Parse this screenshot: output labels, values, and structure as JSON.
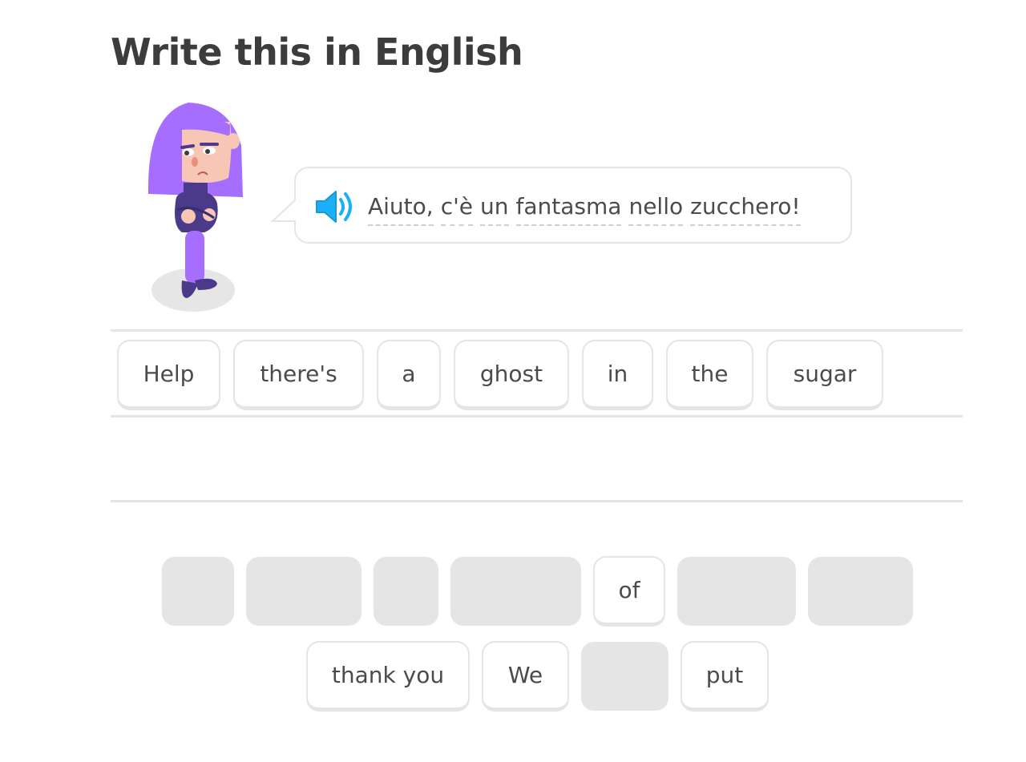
{
  "header": {
    "title": "Write this in English"
  },
  "prompt": {
    "speaker_icon": "speaker-icon",
    "tokens": [
      "Aiuto,",
      "c'è",
      "un",
      "fantasma",
      "nello",
      "zucchero!"
    ]
  },
  "answer": {
    "tiles": [
      "Help",
      "there's",
      "a",
      "ghost",
      "in",
      "the",
      "sugar"
    ]
  },
  "word_bank": {
    "row1": [
      {
        "label": "",
        "used": true
      },
      {
        "label": "",
        "used": true
      },
      {
        "label": "",
        "used": true
      },
      {
        "label": "",
        "used": true
      },
      {
        "label": "of",
        "used": false
      },
      {
        "label": "",
        "used": true
      },
      {
        "label": "",
        "used": true
      }
    ],
    "row2": [
      {
        "label": "thank you",
        "used": false
      },
      {
        "label": "We",
        "used": false
      },
      {
        "label": "",
        "used": true
      },
      {
        "label": "put",
        "used": false
      }
    ]
  },
  "colors": {
    "text": "#3c3c3c",
    "border": "#e5e5e5",
    "speaker_blue": "#1cb0f6",
    "character_purple": "#a56efe",
    "character_dark": "#4b3a8a"
  }
}
